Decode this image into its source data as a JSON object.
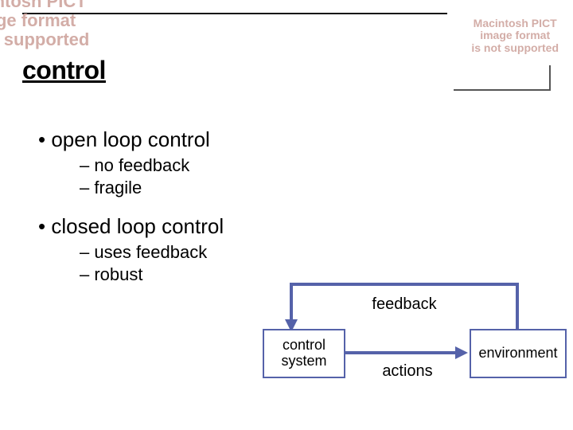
{
  "title": "control",
  "bullets": {
    "open": {
      "heading": "open loop control",
      "subs": [
        "no feedback",
        "fragile"
      ]
    },
    "closed": {
      "heading": "closed loop control",
      "subs": [
        "uses feedback",
        "robust"
      ]
    }
  },
  "diagram": {
    "feedback_label": "feedback",
    "actions_label": "actions",
    "control_box": "control\nsystem",
    "env_box": "environment"
  },
  "pict_warning": "Macintosh PICT\nimage format\nis not supported"
}
